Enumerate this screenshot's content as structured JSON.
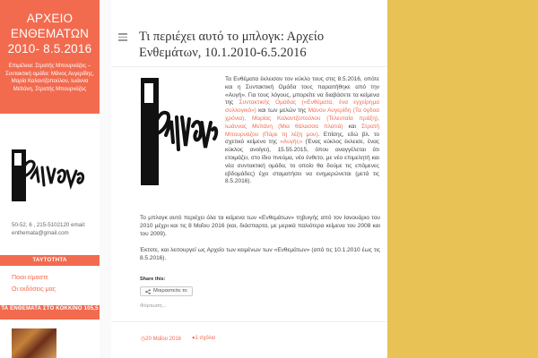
{
  "site": {
    "title": "ΑΡΧΕΙΟ ΕΝΘΕΜΑΤΩΝ 2010- 8.5.2016",
    "description": "Επιμέλεια: Στρατής Μπουρνάζος – Συντακτική ομάδα: Μάνος Αυγερίδης, Μαρία Καλαντζοπούλου, Ιωάννα Μεϊτάνη, Στρατής Μπουρνάζος"
  },
  "sidebar": {
    "address": "50-52, 6 , 215-5102120 email: enthemata@gmail.com",
    "widget_identity": "ΤΑΥΤΟΤΗΤΑ",
    "link_who": "Ποιοι είμαστε",
    "link_editions": "Οι εκδόσεις μας",
    "widget_kokkino": "ΤΑ ΕΝΘΕΜΑΤΑ ΣΤΟ ΚΟΚΚΙΝΟ 105,5"
  },
  "post": {
    "title": "Τι περιέχει αυτό το μπλογκ: Αρχείο Ενθεμάτων, 10.1.2010-6.5.2016",
    "p1": "Τα Ενθέματα έκλεισαν τον κύκλο τους στις 8.5.2016, οπότε και η Συντακτική Ομάδα τους παραιτήθηκε από την «Αυγή». Για τους λόγους, μπορείτε να διαβάσετε τα κείμενα της ",
    "p1_link1": "Συντακτικής Ομάδας («Ενθέματα, ένα εγχείρημα συλλογικό»)",
    "p1_mid": " και των μελών της ",
    "p1_link2": "Μάνου Αυγερίδη (Τα όγδοα χρόνια), Μαρίας Καλαντζοπούλου (Τελευταία πράξη), Ιωάννας Μεϊτάνη (Μια θάλασσα πλατιά)",
    "p1_and": " και ",
    "p1_link3": "Στρατή Μπουρνάζου (Πάρε τη λέξη μου)",
    "p1_tail": ". Επίσης, εδώ βλ. το σχετικό κείμενο της ",
    "p1_link4": "«Αυγής»",
    "p1_end": " (Ένας κύκλος έκλεισε, ένας κύκλος ανοίγει), 15.55.2015, όπου αναγγέλεται ότι ετοιμάζει, στο ίδιο πνεύμα, νέο ένθετο, με νέο επιμελητή και νέα συντακτική ομάδα, το οποίο θα δούμε τις επόμενες εβδομάδες) έχει σταματήσει να ενημερώνεται (μετά τις 8.5.2016).",
    "p2": "Το μπλογκ αυτό περιέχει όλα τα κείμενα των «Ενθεμάτων» τηβυιγής από τον Ιανουάριο του 2010 μέχρι και τις 8 Μαΐου 2016 (και, διάσπαρτα, με μερικά παλιότερα κείμενα του 2008 και του 2009).",
    "p3": "Έκτοτε, και λειτουργεί ως Αρχείο των κειμένων των «Ενθεμάτων» (από τις 10.1.2010 έως τις 8.5.2016).",
    "share_label": "Share this:",
    "share_button": "Μοιραστείτε το",
    "loading": "Φόρτωση...",
    "date": "20 Μαΐου 2016",
    "comments": "1 σχόλιο"
  },
  "logo_text": "Ενθέματα",
  "colors": {
    "accent": "#f26b4f",
    "background": "#e8c254"
  }
}
